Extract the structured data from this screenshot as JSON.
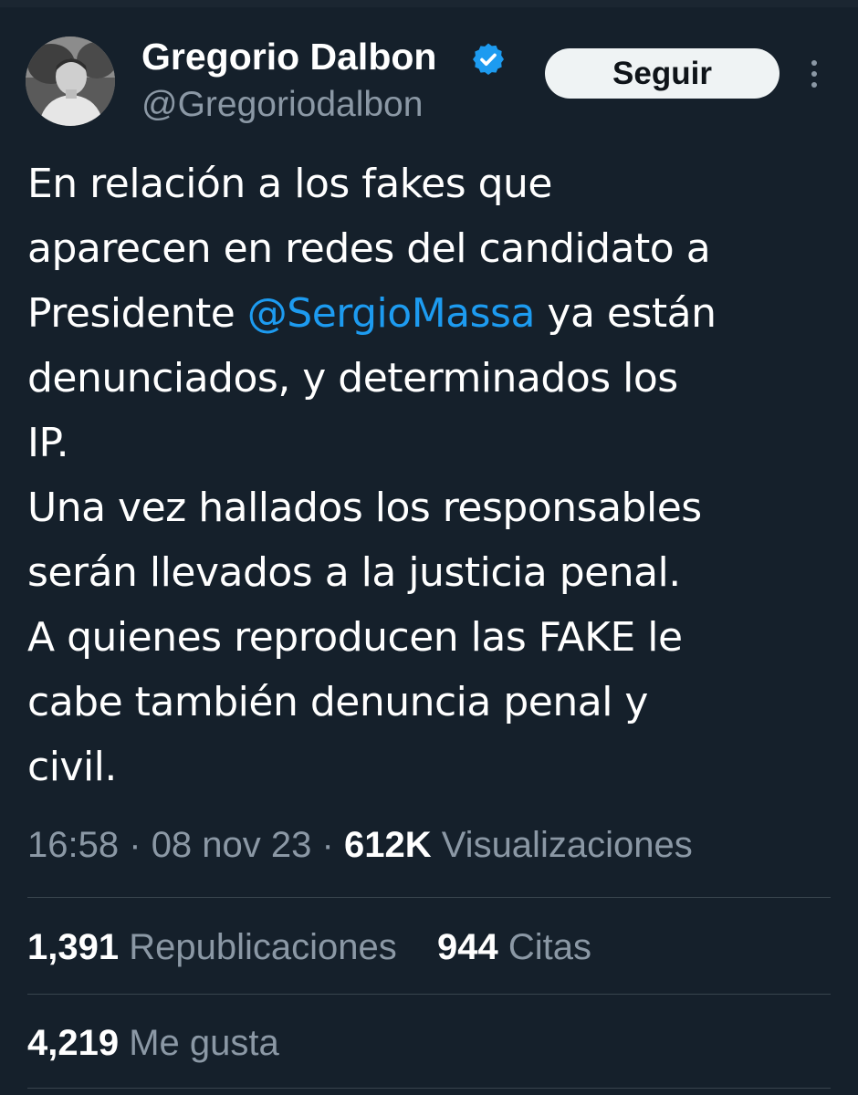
{
  "author": {
    "name": "Gregorio Dalbon",
    "handle": "@Gregoriodalbon",
    "verified": true
  },
  "actions": {
    "follow_label": "Seguir",
    "more_icon": "more-vertical-icon"
  },
  "tweet": {
    "lines": [
      {
        "text": "En relación a los fakes que"
      },
      {
        "text": "aparecen en redes del candidato a"
      },
      {
        "before": "Presidente ",
        "mention": "@SergioMassa",
        "after": " ya están"
      },
      {
        "text": "denunciados, y determinados los"
      },
      {
        "text": "IP."
      },
      {
        "text": "Una vez hallados los responsables"
      },
      {
        "text": "serán llevados a la justicia penal."
      },
      {
        "text": "A quienes reproducen las FAKE le"
      },
      {
        "text": "cabe también denuncia penal y"
      },
      {
        "text": "civil."
      }
    ]
  },
  "meta": {
    "time": "16:58",
    "date": "08 nov 23",
    "separator": "·",
    "views_count": "612K",
    "views_label": "Visualizaciones"
  },
  "stats": {
    "reposts_count": "1,391",
    "reposts_label": "Republicaciones",
    "quotes_count": "944",
    "quotes_label": "Citas",
    "likes_count": "4,219",
    "likes_label": "Me gusta"
  },
  "colors": {
    "background": "#15202b",
    "text": "#ffffff",
    "secondary_text": "#8b98a5",
    "link": "#1d9bf0",
    "divider": "#38444d",
    "button_bg": "#eff3f4"
  }
}
